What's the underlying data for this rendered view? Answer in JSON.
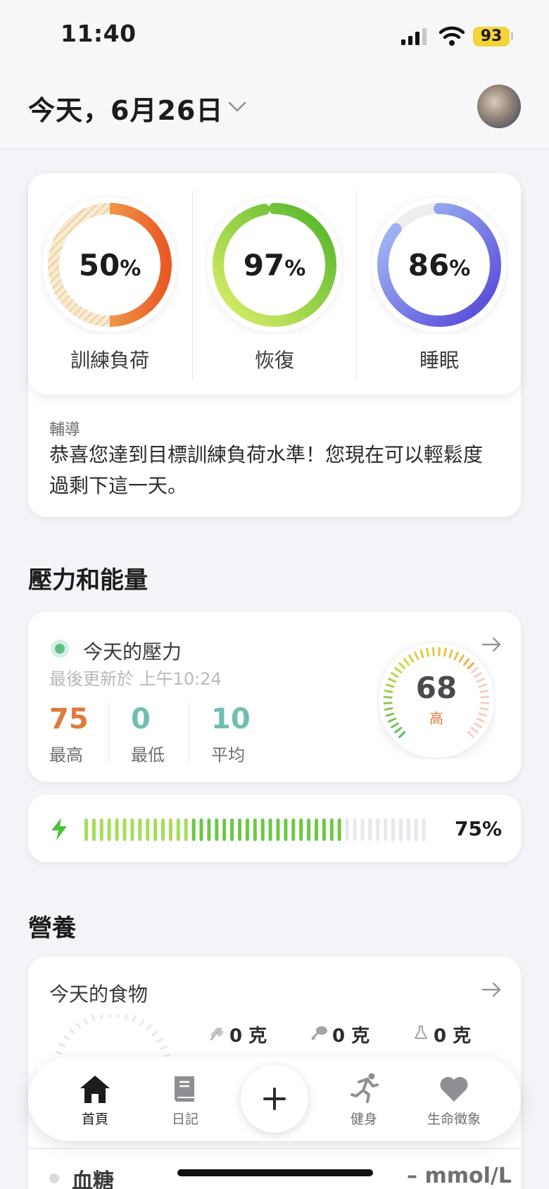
{
  "status_bar": {
    "time": "11:40",
    "battery": "93"
  },
  "header": {
    "date_title": "今天，6月26日"
  },
  "rings": [
    {
      "value": "50",
      "unit": "%",
      "label": "訓練負荷",
      "fraction": 0.5
    },
    {
      "value": "97",
      "unit": "%",
      "label": "恢復",
      "fraction": 0.97
    },
    {
      "value": "86",
      "unit": "%",
      "label": "睡眠",
      "fraction": 0.86
    }
  ],
  "coaching": {
    "heading": "輔導",
    "text": "恭喜您達到目標訓練負荷水準！您現在可以輕鬆度過剩下這一天。"
  },
  "stress_section": {
    "title": "壓力和能量",
    "card_title": "今天的壓力",
    "updated": "最後更新於 上午10:24",
    "stats": [
      {
        "value": "75",
        "label": "最高",
        "color": "#e07a3c"
      },
      {
        "value": "0",
        "label": "最低",
        "color": "#6fbfb0"
      },
      {
        "value": "10",
        "label": "平均",
        "color": "#6fbfb0"
      }
    ],
    "gauge_value": "68",
    "gauge_level": "高",
    "gauge_fraction": 0.68
  },
  "energy": {
    "percent_label": "75%",
    "fraction": 0.75
  },
  "nutrition": {
    "title": "營養",
    "card_title": "今天的食物",
    "macros": [
      {
        "icon": "grain-icon",
        "value": "0 克"
      },
      {
        "icon": "meat-icon",
        "value": "0 克"
      },
      {
        "icon": "flask-icon",
        "value": "0 克"
      }
    ]
  },
  "tabbar": {
    "home": "首頁",
    "diary": "日記",
    "fitness": "健身",
    "vitals": "生命徵象"
  },
  "glucose": {
    "label": "血糖",
    "value": "– mmol/L"
  }
}
